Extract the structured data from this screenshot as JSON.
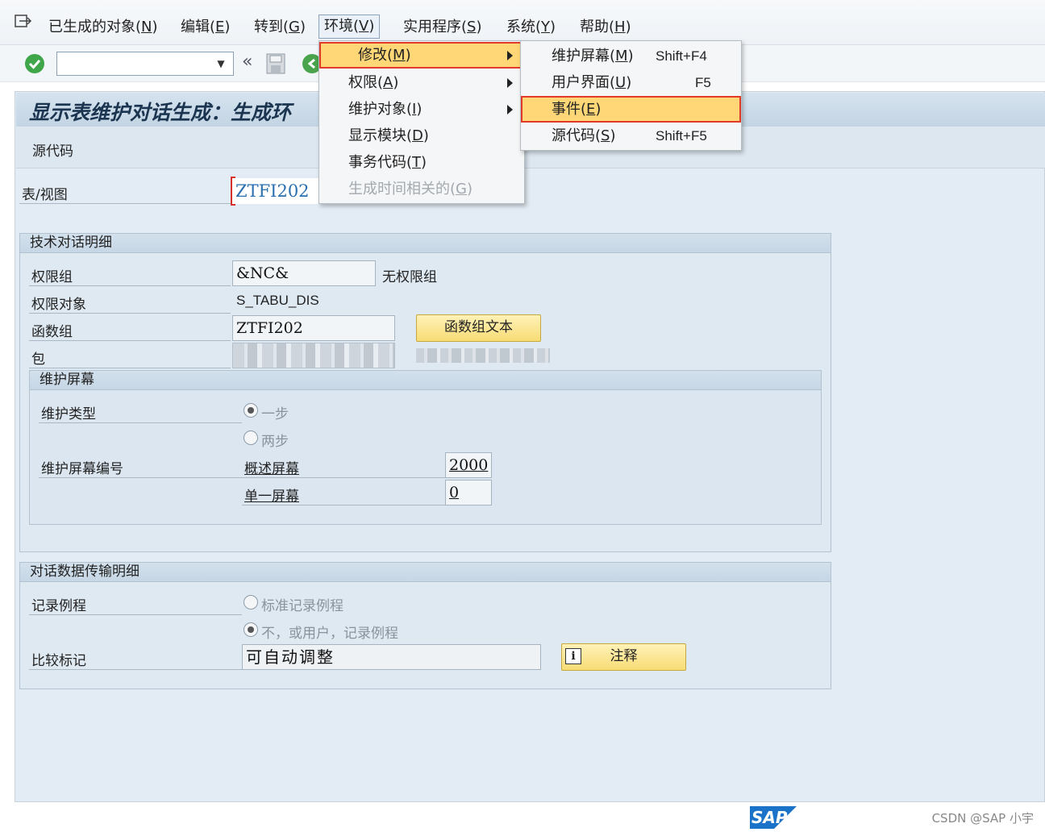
{
  "menubar": {
    "items": [
      {
        "text": "已生成的对象(",
        "key": "N",
        "suffix": ")"
      },
      {
        "text": "编辑(",
        "key": "E",
        "suffix": ")"
      },
      {
        "text": "转到(",
        "key": "G",
        "suffix": ")"
      },
      {
        "text": "环境(",
        "key": "V",
        "suffix": ")"
      },
      {
        "text": "实用程序(",
        "key": "S",
        "suffix": ")"
      },
      {
        "text": "系统(",
        "key": "Y",
        "suffix": ")"
      },
      {
        "text": "帮助(",
        "key": "H",
        "suffix": ")"
      }
    ]
  },
  "toolbar": {
    "command_value": "",
    "icons": [
      "enter-check-icon",
      "back-double-arrow-icon",
      "save-icon",
      "green-back-icon"
    ]
  },
  "page": {
    "title": "显示表维护对话生成：生成环",
    "source_code_btn": "源代码",
    "table_view_label": "表/视图",
    "table_view_value": "ZTFI202"
  },
  "tech_details": {
    "title": "技术对话明细",
    "auth_group_label": "权限组",
    "auth_group_value": "&NC&",
    "auth_group_text": "无权限组",
    "auth_object_label": "权限对象",
    "auth_object_value": "S_TABU_DIS",
    "function_group_label": "函数组",
    "function_group_value": "ZTFI202",
    "function_group_btn": "函数组文本",
    "package_label": "包"
  },
  "maint_screen": {
    "title": "维护屏幕",
    "type_label": "维护类型",
    "one_step": "一步",
    "two_step": "两步",
    "screen_no_label": "维护屏幕编号",
    "overview_label": "概述屏幕",
    "overview_value": "2000",
    "single_label": "单一屏幕",
    "single_value": "0"
  },
  "data_transport": {
    "title": "对话数据传输明细",
    "routine_label": "记录例程",
    "standard_routine": "标准记录例程",
    "no_routine": "不，或用户，记录例程",
    "compare_label": "比较标记",
    "compare_value": "可自动调整",
    "note_btn": "注释"
  },
  "env_menu": {
    "items": [
      {
        "text": "修改(",
        "key": "M",
        "suffix": ")"
      },
      {
        "text": "权限(",
        "key": "A",
        "suffix": ")"
      },
      {
        "text": "维护对象(",
        "key": "I",
        "suffix": ")"
      },
      {
        "text": "显示模块(",
        "key": "D",
        "suffix": ")"
      },
      {
        "text": "事务代码(",
        "key": "T",
        "suffix": ")"
      },
      {
        "text": "生成时间相关的(",
        "key": "G",
        "suffix": ")"
      }
    ]
  },
  "modify_menu": {
    "items": [
      {
        "text": "维护屏幕(",
        "key": "M",
        "suffix": ")",
        "shortcut": "Shift+F4"
      },
      {
        "text": "用户界面(",
        "key": "U",
        "suffix": ")",
        "shortcut": "F5"
      },
      {
        "text": "事件(",
        "key": "E",
        "suffix": ")",
        "shortcut": ""
      },
      {
        "text": "源代码(",
        "key": "S",
        "suffix": ")",
        "shortcut": "Shift+F5"
      }
    ]
  },
  "footer": {
    "sap_logo": "SAP",
    "watermark": "CSDN @SAP 小宇"
  },
  "colors": {
    "menu_highlight": "#ffd776",
    "highlight_border": "#e23a2a",
    "button_yellow": "#f8dc75",
    "group_bg": "#dfe9f2",
    "sap_blue": "#1a73c9"
  }
}
